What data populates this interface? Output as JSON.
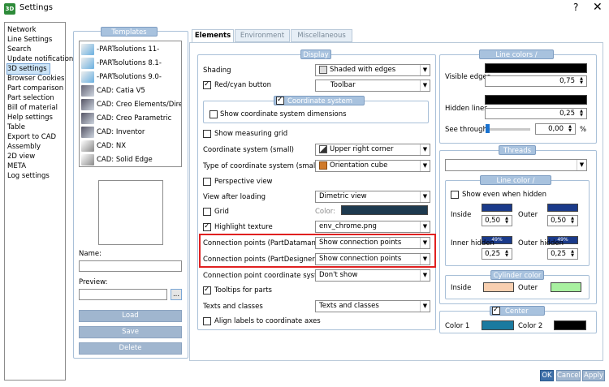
{
  "window": {
    "title": "Settings",
    "icon_text": "3D",
    "help": "?",
    "close": "✕"
  },
  "nav": {
    "items": [
      {
        "label": "Network"
      },
      {
        "label": "Line Settings"
      },
      {
        "label": "Search"
      },
      {
        "label": "Update notification"
      },
      {
        "label": "3D settings",
        "selected": true
      },
      {
        "label": "Browser Cookies"
      },
      {
        "label": "Part comparison"
      },
      {
        "label": "Part selection"
      },
      {
        "label": "Bill of material"
      },
      {
        "label": "Help settings"
      },
      {
        "label": "Table"
      },
      {
        "label": "Export to CAD"
      },
      {
        "label": "Assembly"
      },
      {
        "label": "2D view"
      },
      {
        "label": "META"
      },
      {
        "label": "Log settings"
      }
    ]
  },
  "templates": {
    "title": "Templates",
    "items": [
      {
        "label": "-PARTsolutions 11-"
      },
      {
        "label": "-PARTsolutions 8.1-"
      },
      {
        "label": "-PARTsolutions 9.0-"
      },
      {
        "label": "CAD: Catia V5"
      },
      {
        "label": "CAD: Creo Elements/Direc"
      },
      {
        "label": "CAD: Creo Parametric"
      },
      {
        "label": "CAD: Inventor"
      },
      {
        "label": "CAD: NX"
      },
      {
        "label": "CAD: Solid Edge"
      }
    ],
    "name_label": "Name:",
    "preview_label": "Preview:",
    "browse": "...",
    "load": "Load",
    "save": "Save",
    "delete": "Delete"
  },
  "tabs": {
    "elements": "Elements",
    "environment": "Environment",
    "misc": "Miscellaneous"
  },
  "display": {
    "title": "Display",
    "shading_label": "Shading",
    "shading_value": "Shaded with edges",
    "redcyan_label": "Red/cyan button",
    "redcyan_value": "Toolbar",
    "coord_large_title": "Coordinate system (large)",
    "show_coord_dims": "Show coordinate system dimensions",
    "show_measuring_grid": "Show measuring grid",
    "coord_small_label": "Coordinate system (small)",
    "coord_small_value": "Upper right corner",
    "coord_type_label": "Type of coordinate system (small)",
    "coord_type_value": "Orientation cube",
    "perspective": "Perspective view",
    "view_after_loading_label": "View after loading",
    "view_after_loading_value": "Dimetric view",
    "grid": "Grid",
    "color_label": "Color:",
    "highlight_texture": "Highlight texture",
    "highlight_texture_value": "env_chrome.png",
    "cp_datamanager_label": "Connection points (PartDatamanager)",
    "cp_datamanager_value": "Show connection points",
    "cp_designer_label": "Connection points (PartDesigner)",
    "cp_designer_value": "Show connection points",
    "cp_coord_label": "Connection point coordinate system",
    "cp_coord_value": "Don't show",
    "tooltips": "Tooltips for parts",
    "texts_label": "Texts and classes",
    "texts_value": "Texts and classes",
    "align_labels": "Align labels to coordinate axes"
  },
  "line_colors": {
    "title": "Line colors / thickness",
    "visible_edges": "Visible edges",
    "visible_value": "0,75",
    "hidden_lines": "Hidden lines",
    "hidden_value": "0,25",
    "see_through": "See through:",
    "see_through_value": "0,00",
    "see_through_unit": "%",
    "see_through_level": 0
  },
  "threads": {
    "title": "Threads",
    "sub_title": "Line color / thickness",
    "show_hidden": "Show even when hidden",
    "inside": "Inside",
    "outer": "Outer",
    "inside_value": "0,50",
    "outer_value": "0,50",
    "inner_hidden": "Inner hidden",
    "outer_hidden": "Outer hidden",
    "inner_hidden_value": "0,25",
    "outer_hidden_value": "0,25",
    "pct_inner": "49%",
    "pct_outer": "49%"
  },
  "cylinder": {
    "title": "Cylinder color",
    "inside": "Inside",
    "outer": "Outer"
  },
  "center_point": {
    "title": "Center point",
    "color1": "Color 1",
    "color2": "Color 2"
  },
  "buttons": {
    "ok": "OK",
    "cancel": "Cancel",
    "apply": "Apply"
  },
  "colors": {
    "grid_color": "#1e3a4f",
    "inner_blue": "#1a3a8a",
    "cylinder_inside": "#f8cfb0",
    "cylinder_outer": "#a8f0a0",
    "center_color1": "#1a7aa0",
    "center_color2": "#000000"
  }
}
